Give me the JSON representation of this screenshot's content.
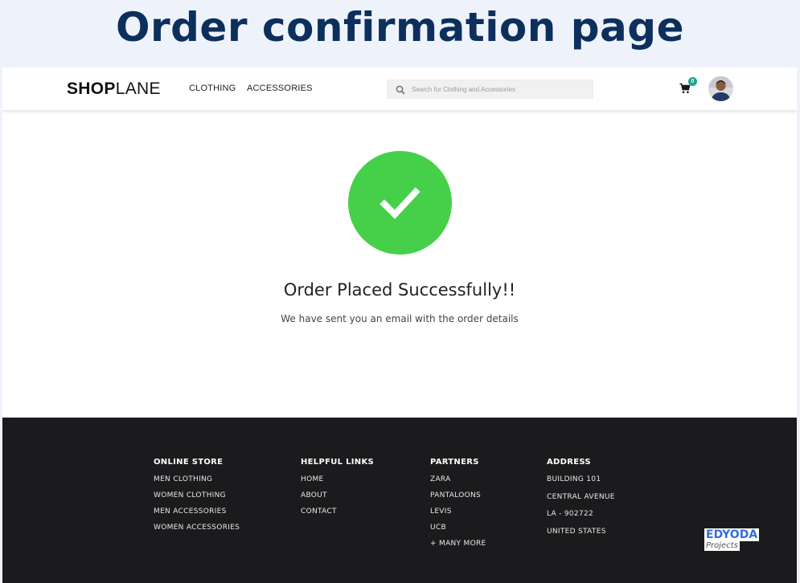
{
  "banner": {
    "title": "Order confirmation page"
  },
  "navbar": {
    "logo_bold": "SHOP",
    "logo_light": "LANE",
    "links": [
      "CLOTHING",
      "ACCESSORIES"
    ],
    "search_placeholder": "Search for Clothing and Accessories",
    "search_icon": "magnifier-icon",
    "cart_icon": "shopping-cart-icon",
    "cart_count": "0",
    "avatar": "user-avatar"
  },
  "confirmation": {
    "icon": "checkmark-icon",
    "success_color": "#46d04a",
    "title": "Order Placed Successfully!!",
    "subtitle": "We have sent you an email with the order details"
  },
  "footer": {
    "columns": [
      {
        "heading": "ONLINE STORE",
        "items": [
          "MEN CLOTHING",
          "WOMEN CLOTHING",
          "MEN ACCESSORIES",
          "WOMEN ACCESSORIES"
        ]
      },
      {
        "heading": "HELPFUL LINKS",
        "items": [
          "HOME",
          "ABOUT",
          "CONTACT"
        ]
      },
      {
        "heading": "PARTNERS",
        "items": [
          "ZARA",
          "PANTALOONS",
          "LEVIS",
          "UCB",
          "+ MANY MORE"
        ]
      },
      {
        "heading": "ADDRESS",
        "items": [
          "BUILDING 101",
          "CENTRAL AVENUE",
          "LA - 902722",
          "UNITED STATES"
        ]
      }
    ],
    "watermark_top": "EDYODA",
    "watermark_bottom": "Projects"
  }
}
